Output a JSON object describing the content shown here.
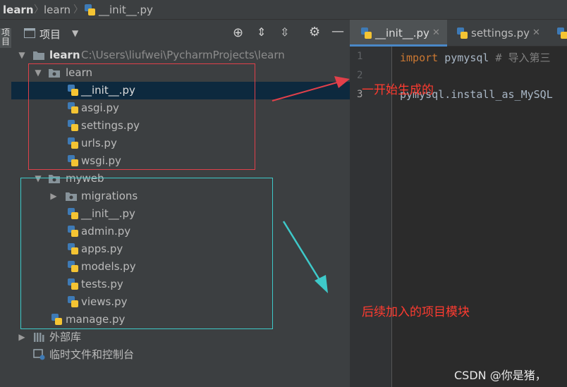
{
  "breadcrumb": {
    "project": "learn",
    "folder": "learn",
    "file": "__init__.py"
  },
  "side_strip": {
    "label": "项目"
  },
  "panel": {
    "title": "项目"
  },
  "tree": {
    "root": {
      "label": "learn",
      "path": "C:\\Users\\liufwei\\PycharmProjects\\learn"
    },
    "learn_pkg": {
      "label": "learn",
      "files": [
        "__init__.py",
        "asgi.py",
        "settings.py",
        "urls.py",
        "wsgi.py"
      ]
    },
    "myweb_pkg": {
      "label": "myweb",
      "migrations": "migrations",
      "files": [
        "__init__.py",
        "admin.py",
        "apps.py",
        "models.py",
        "tests.py",
        "views.py"
      ]
    },
    "manage": "manage.py",
    "external_libs": "外部库",
    "scratches": "临时文件和控制台"
  },
  "editor": {
    "tabs": [
      {
        "label": "__init__.py"
      },
      {
        "label": "settings.py"
      }
    ],
    "line_numbers": [
      "1",
      "2",
      "3"
    ],
    "code": {
      "line1_kw": "import",
      "line1_rest": " pymysql",
      "line1_comment": "# 导入第三",
      "line3": "pymysql.install_as_MySQL"
    }
  },
  "annotations": {
    "initial": "一开始生成的",
    "added": "后续加入的项目模块"
  },
  "watermark": "CSDN @你是猪，",
  "colors": {
    "red_box": "#e0404a",
    "cyan_box": "#3ec9c9",
    "selection": "#0d293e",
    "folder_blue": "#87939a",
    "py_blue": "#3e7ab5",
    "py_yellow": "#f4c433",
    "annotation_red": "#ff3b30"
  }
}
